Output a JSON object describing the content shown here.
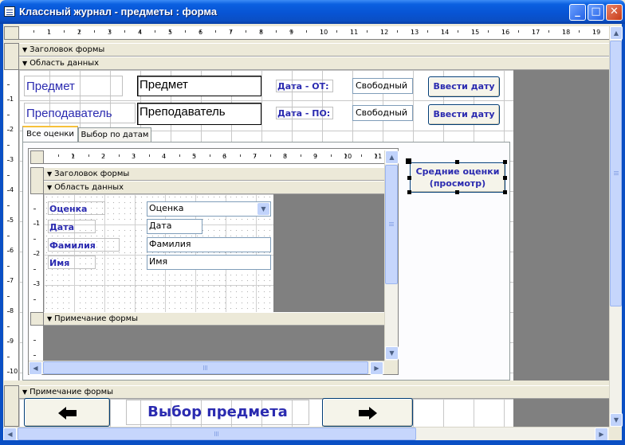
{
  "window": {
    "title": "Классный журнал - предметы : форма",
    "minimize": "_",
    "maximize": "□",
    "close": "✕"
  },
  "sections": {
    "form_header": "Заголовок формы",
    "detail": "Область данных",
    "form_footer": "Примечание формы"
  },
  "ruler_top": [
    "1",
    "2",
    "3",
    "4",
    "5",
    "6",
    "7",
    "8",
    "9",
    "10",
    "11",
    "12",
    "13",
    "14",
    "15",
    "16",
    "17",
    "18",
    "19"
  ],
  "ruler_left": [
    "1",
    "2",
    "3",
    "4",
    "5",
    "6",
    "7",
    "8",
    "9",
    "10"
  ],
  "main": {
    "subject_label": "Предмет",
    "subject_field": "Предмет",
    "teacher_label": "Преподаватель",
    "teacher_field": "Преподаватель",
    "date_from_label": "Дата - ОТ:",
    "date_from_field": "Свободный",
    "date_to_label": "Дата - ПО:",
    "date_to_field": "Свободный",
    "enter_date_button_1": "Ввести дату",
    "enter_date_button_2": "Ввести дату",
    "avg_grades_button": "Средние оценки (просмотр)"
  },
  "tabs": [
    {
      "label": "Все оценки",
      "active": true
    },
    {
      "label": "Выбор по датам",
      "active": false
    }
  ],
  "subform": {
    "ruler_top": [
      "1",
      "2",
      "3",
      "4",
      "5",
      "6",
      "7",
      "8",
      "9",
      "10",
      "11"
    ],
    "ruler_left": [
      "1",
      "2",
      "3"
    ],
    "header_section": "Заголовок формы",
    "detail_section": "Область данных",
    "footer_section": "Примечание формы",
    "fields": [
      {
        "label": "Оценка",
        "value": "Оценка",
        "type": "combo"
      },
      {
        "label": "Дата",
        "value": "Дата",
        "type": "text"
      },
      {
        "label": "Фамилия",
        "value": "Фамилия",
        "type": "text"
      },
      {
        "label": "Имя",
        "value": "Имя",
        "type": "text"
      }
    ]
  },
  "footer": {
    "prev_button_icon": "arrow-left-icon",
    "title": "Выбор предмета",
    "next_button_icon": "arrow-right-icon"
  }
}
